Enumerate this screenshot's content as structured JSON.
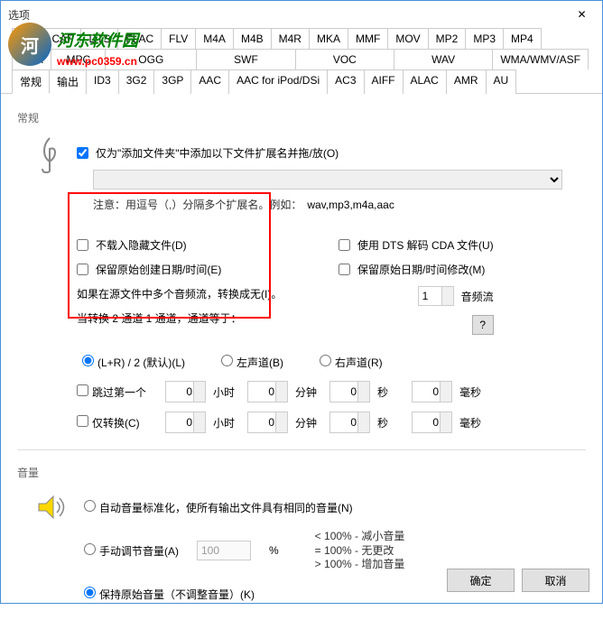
{
  "window": {
    "title": "选项",
    "close": "✕"
  },
  "logo": {
    "name": "河东软件园",
    "url": "www.pc0359.cn"
  },
  "format_tabs_row1": [
    "AVI",
    "CAF",
    "DTS",
    "FLAC",
    "FLV",
    "M4A",
    "M4B",
    "M4R",
    "MKA",
    "MMF",
    "MOV",
    "MP2",
    "MP3",
    "MP4"
  ],
  "format_tabs_row2": [
    "MPA",
    "MPC",
    "OGG",
    "SWF",
    "VOC",
    "WAV",
    "WMA/WMV/ASF"
  ],
  "option_tabs": [
    "常规",
    "输出",
    "ID3",
    "3G2",
    "3GP",
    "AAC",
    "AAC for iPod/DSi",
    "AC3",
    "AIFF",
    "ALAC",
    "AMR",
    "AU"
  ],
  "active_tab": "常规",
  "general": {
    "title": "常规",
    "add_folder_check": "仅为\"添加文件夹\"中添加以下文件扩展名并拖/放(O)",
    "ext_note": "注意：用逗号（,）分隔多个扩展名。例如：",
    "ext_example": "wav,mp3,m4a,aac",
    "no_hidden": "不载入隐藏文件(D)",
    "use_dts": "使用 DTS 解码 CDA 文件(U)",
    "keep_create": "保留原始创建日期/时间(E)",
    "keep_modify": "保留原始日期/时间修改(M)",
    "multi_stream": "如果在源文件中多个音频流，转换成无(I)。",
    "stream_val": "1",
    "stream_label": "音频流",
    "channel_note": "当转换 2 通道 1 通道，通道等于：",
    "qmark": "?",
    "r1": "(L+R) / 2 (默认)(L)",
    "r2": "左声道(B)",
    "r3": "右声道(R)",
    "skip_first": "跳过第一个",
    "convert_only": "仅转换(C)",
    "hour": "小时",
    "min": "分钟",
    "sec": "秒",
    "ms": "毫秒",
    "zero": "0"
  },
  "volume": {
    "title": "音量",
    "auto": "自动音量标准化，使所有输出文件具有相同的音量(N)",
    "manual": "手动调节音量(A)",
    "manual_val": "100",
    "pct": "%",
    "help1": "< 100% - 减小音量",
    "help2": "= 100% - 无更改",
    "help3": "> 100% - 增加音量",
    "keep": "保持原始音量（不调整音量）(K)"
  },
  "buttons": {
    "ok": "确定",
    "cancel": "取消"
  }
}
